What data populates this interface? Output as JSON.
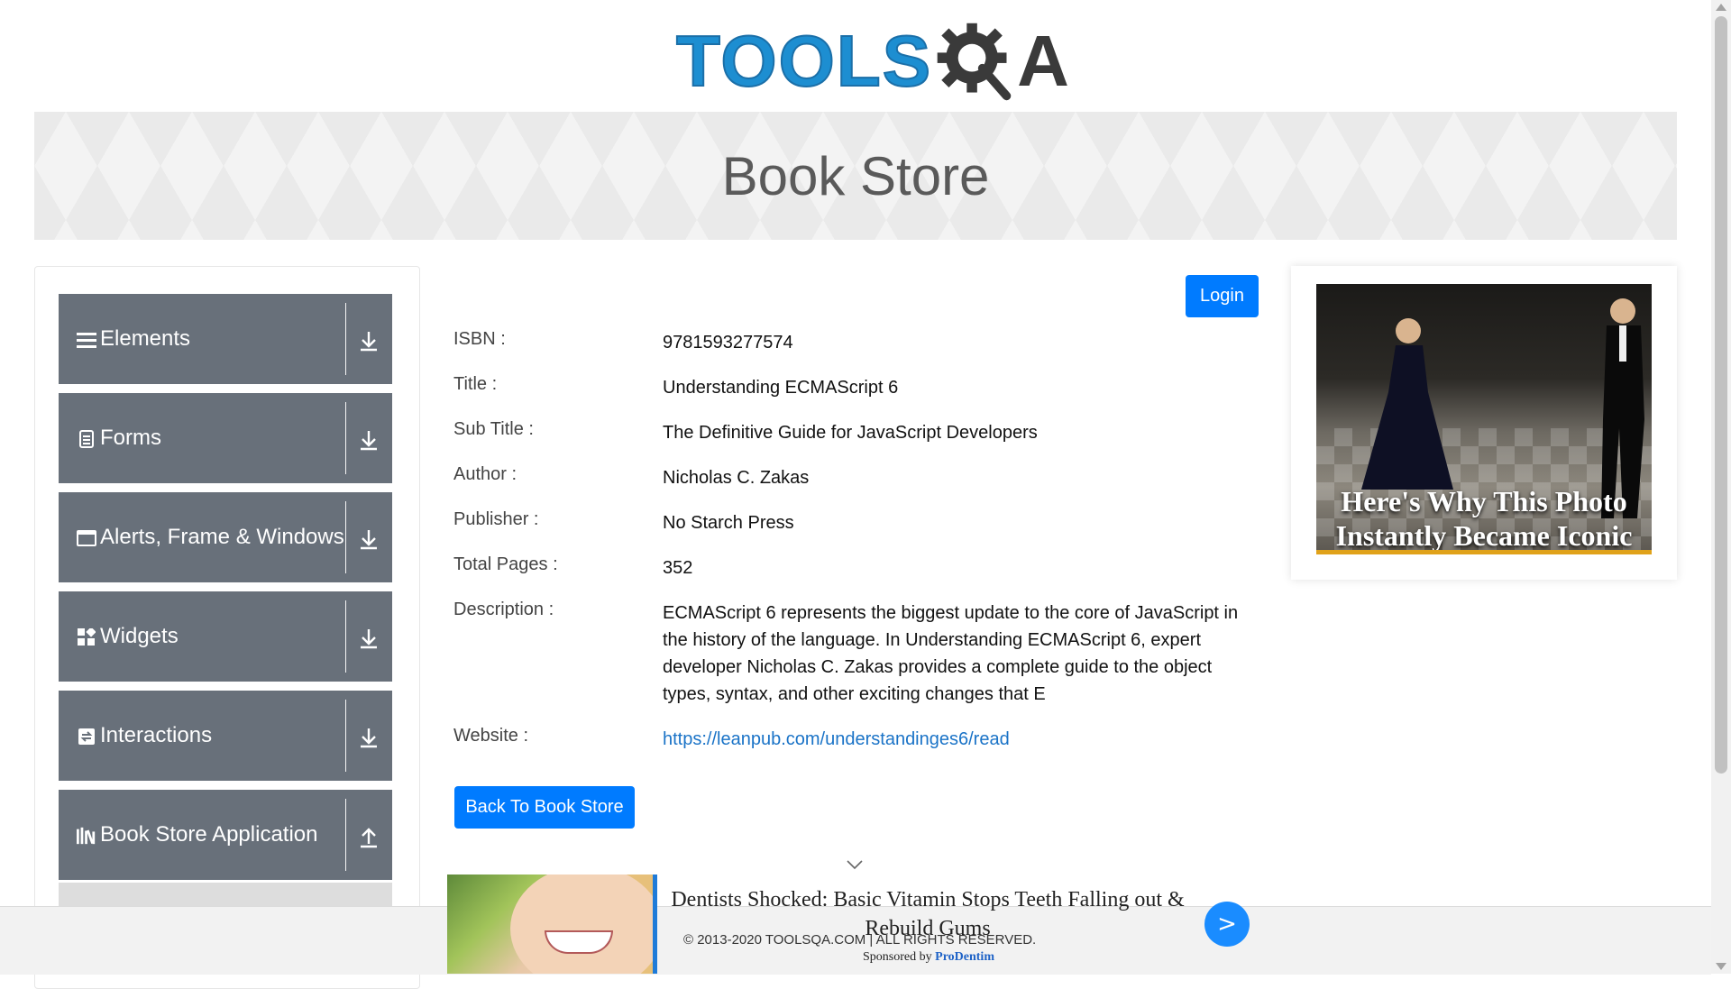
{
  "header": {
    "logo_text": "TOOLSQA"
  },
  "banner": {
    "title": "Book Store"
  },
  "sidebar": {
    "groups": [
      {
        "label": "Elements",
        "icon": "menu-icon",
        "expanded": false
      },
      {
        "label": "Forms",
        "icon": "document-icon",
        "expanded": false
      },
      {
        "label": "Alerts, Frame & Windows",
        "icon": "window-icon",
        "expanded": false
      },
      {
        "label": "Widgets",
        "icon": "grid-icon",
        "expanded": false
      },
      {
        "label": "Interactions",
        "icon": "interaction-icon",
        "expanded": false
      },
      {
        "label": "Book Store Application",
        "icon": "library-icon",
        "expanded": true
      }
    ]
  },
  "main": {
    "login_label": "Login",
    "book": {
      "isbn_label": "ISBN :",
      "isbn": "9781593277574",
      "title_label": "Title :",
      "title": "Understanding ECMAScript 6",
      "subtitle_label": "Sub Title :",
      "subtitle": "The Definitive Guide for JavaScript Developers",
      "author_label": "Author :",
      "author": "Nicholas C. Zakas",
      "publisher_label": "Publisher :",
      "publisher": "No Starch Press",
      "pages_label": "Total Pages :",
      "pages": "352",
      "description_label": "Description :",
      "description": "ECMAScript 6 represents the biggest update to the core of JavaScript in the history of the language. In Understanding ECMAScript 6, expert developer Nicholas C. Zakas provides a complete guide to the object types, syntax, and other exciting changes that E",
      "website_label": "Website :",
      "website": "https://leanpub.com/understandinges6/read"
    },
    "back_label": "Back To Book Store"
  },
  "right_ad": {
    "caption": "Here's Why This Photo Instantly Became Iconic"
  },
  "bottom_ad": {
    "headline": "Dentists Shocked: Basic Vitamin Stops Teeth Falling out & Rebuild Gums",
    "sponsor_prefix": "Sponsored by",
    "sponsor_name": "ProDentim",
    "go_label": ">"
  },
  "footer": {
    "copyright": "© 2013-2020 TOOLSQA.COM | ALL RIGHTS RESERVED."
  },
  "colors": {
    "primary": "#007bff",
    "sidebar_group": "#68707a",
    "logo_blue": "#1d8ed1",
    "link": "#1a73c7"
  }
}
